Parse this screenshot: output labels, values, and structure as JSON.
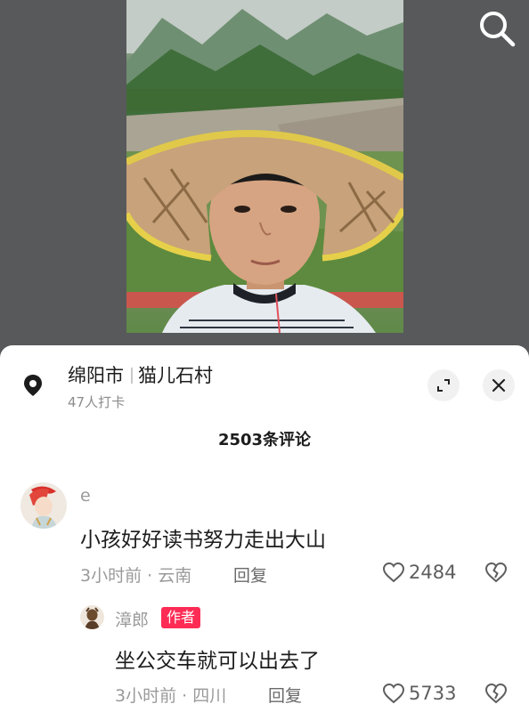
{
  "location": {
    "city": "绵阳市",
    "place": "猫儿石村",
    "checkins": "47人打卡"
  },
  "comments_header": "2503条评论",
  "comments": [
    {
      "user": "e",
      "text": "小孩好好读书努力走出大山",
      "time": "3小时前",
      "region": "云南",
      "reply_label": "回复",
      "likes": "2484"
    }
  ],
  "replies": [
    {
      "user": "漳郎",
      "badge": "作者",
      "text": "坐公交车就可以出去了",
      "time": "3小时前",
      "region": "四川",
      "reply_label": "回复",
      "likes": "5733"
    }
  ],
  "colors": {
    "accent": "#fe2c55",
    "sheet": "#ffffff",
    "backdrop": "#5a5b5d"
  },
  "icons": [
    "search-icon",
    "location-pin-icon",
    "expand-icon",
    "close-icon",
    "heart-icon",
    "broken-heart-icon"
  ]
}
